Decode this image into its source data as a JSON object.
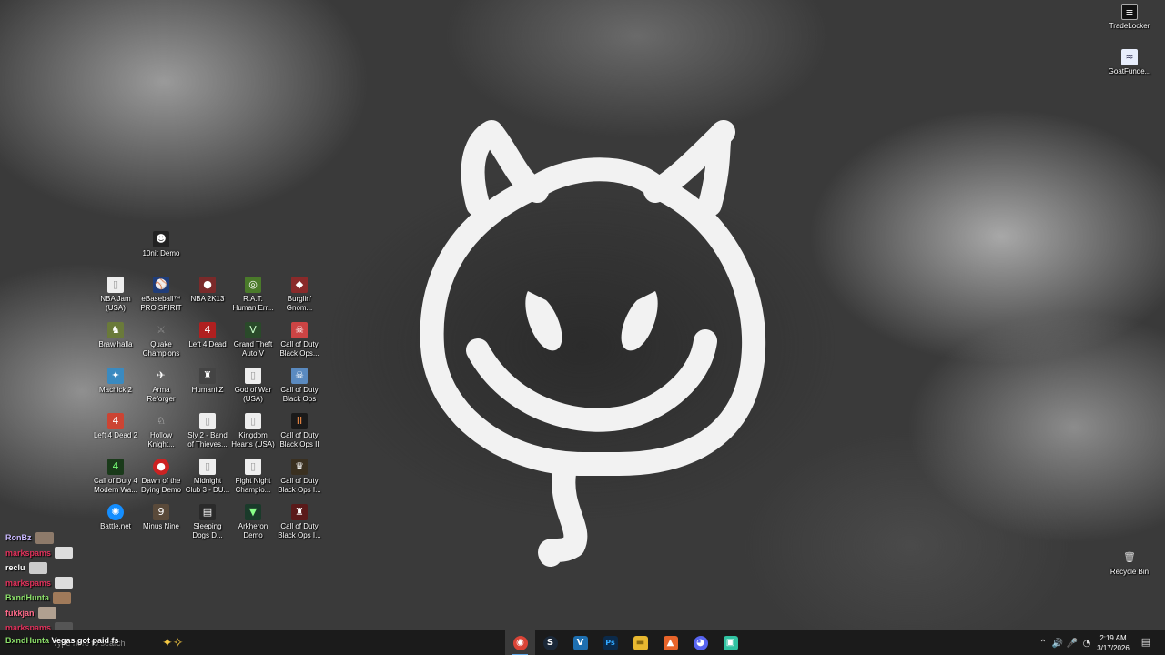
{
  "desktop": {
    "right_icons": [
      {
        "label": "TradeLocker",
        "icon": "tradelocker-icon"
      },
      {
        "label": "GoatFunde...",
        "icon": "goatfunded-icon"
      },
      {
        "label": "Recycle Bin",
        "icon": "recycle-bin-icon"
      }
    ],
    "icons": [
      {
        "label": "10nit Demo"
      },
      {
        "label": "NBA Jam\n(USA)"
      },
      {
        "label": "eBaseball™\nPRO SPIRIT"
      },
      {
        "label": "NBA 2K13"
      },
      {
        "label": "R.A.T.\nHuman Err..."
      },
      {
        "label": "Burglin'\nGnom..."
      },
      {
        "label": "Brawlhalla"
      },
      {
        "label": "Quake\nChampions"
      },
      {
        "label": "Left 4 Dead"
      },
      {
        "label": "Grand Theft\nAuto V"
      },
      {
        "label": "Call of Duty\nBlack Ops..."
      },
      {
        "label": "Machick 2"
      },
      {
        "label": "Arma\nReforger"
      },
      {
        "label": "HumanitZ"
      },
      {
        "label": "God of War\n(USA)"
      },
      {
        "label": "Call of Duty\nBlack Ops"
      },
      {
        "label": "Left 4 Dead 2"
      },
      {
        "label": "Hollow\nKnight..."
      },
      {
        "label": "Sly 2 - Band\nof Thieves..."
      },
      {
        "label": "Kingdom\nHearts (USA)"
      },
      {
        "label": "Call of Duty\nBlack Ops II"
      },
      {
        "label": "Call of Duty 4\nModern Wa..."
      },
      {
        "label": "Dawn of the\nDying Demo"
      },
      {
        "label": "Midnight\nClub 3 - DU..."
      },
      {
        "label": "Fight Night\nChampio..."
      },
      {
        "label": "Call of Duty\nBlack Ops I..."
      },
      {
        "label": "Battle.net"
      },
      {
        "label": "Minus Nine"
      },
      {
        "label": "Sleeping\nDogs D..."
      },
      {
        "label": "Arkheron\nDemo"
      },
      {
        "label": "Call of Duty\nBlack Ops I..."
      }
    ]
  },
  "chat_overlay": [
    {
      "name": "RonBz",
      "color": "#c9b8ff"
    },
    {
      "name": "markspams",
      "color": "#e0305a"
    },
    {
      "name": "reclu",
      "color": "#ffffff"
    },
    {
      "name": "markspams",
      "color": "#e0305a"
    },
    {
      "name": "BxndHunta",
      "color": "#8ce06a"
    },
    {
      "name": "fukkjan",
      "color": "#ff6a8a"
    },
    {
      "name": "markspams",
      "color": "#e0305a"
    }
  ],
  "taskbar": {
    "search_placeholder": "Type here to search",
    "stream_message_user": "BxndHunta",
    "stream_message_text": "Vegas got paid fs",
    "apps": [
      {
        "name": "chrome-icon",
        "glyph": "◉",
        "color": "#db4437",
        "active": true
      },
      {
        "name": "steam-icon",
        "glyph": "S",
        "color": "#1b2838",
        "active": false
      },
      {
        "name": "vscode-icon",
        "glyph": "V",
        "color": "#1e6fb0",
        "active": false
      },
      {
        "name": "photoshop-icon",
        "glyph": "Ps",
        "color": "#0b2a4a",
        "active": false
      },
      {
        "name": "file-explorer-icon",
        "glyph": "▬",
        "color": "#e8b830",
        "active": false
      },
      {
        "name": "brave-icon",
        "glyph": "▲",
        "color": "#e8642a",
        "active": false
      },
      {
        "name": "discord-icon",
        "glyph": "◕",
        "color": "#5865f2",
        "active": false
      },
      {
        "name": "streamlabs-icon",
        "glyph": "▣",
        "color": "#31c3a2",
        "active": false
      }
    ],
    "clock_time": "2:19 AM",
    "clock_date": "3/17/2026"
  }
}
